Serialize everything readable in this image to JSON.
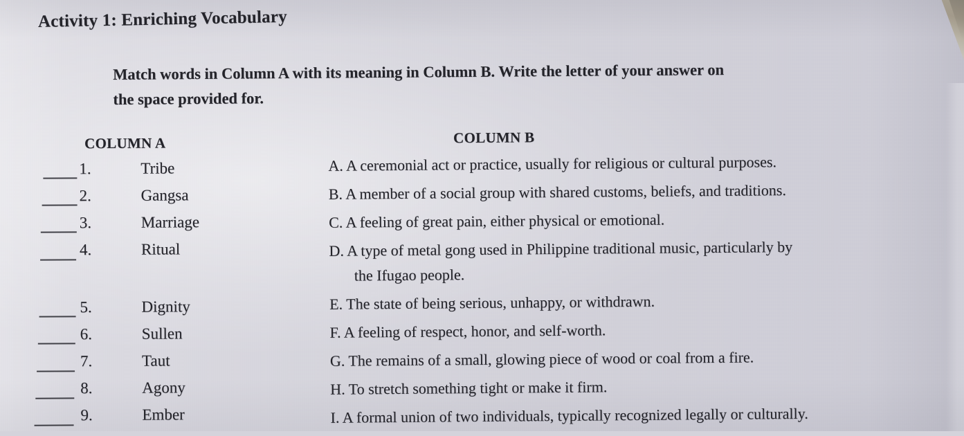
{
  "document": {
    "heading": "Activity 1: Enriching Vocabulary",
    "instructions_line1": "Match words in Column A with its meaning in Column B. Write the letter of your answer on",
    "instructions_line2": "the space provided for.",
    "paper_color": "#d6d5dd",
    "ink_color": "#24242a"
  },
  "column_a": {
    "header": "COLUMN A",
    "items": [
      {
        "number": "1.",
        "word": "Tribe",
        "answer": ""
      },
      {
        "number": "2.",
        "word": "Gangsa",
        "answer": ""
      },
      {
        "number": "3.",
        "word": "Marriage",
        "answer": ""
      },
      {
        "number": "4.",
        "word": "Ritual",
        "answer": ""
      },
      {
        "number": "5.",
        "word": "Dignity",
        "answer": ""
      },
      {
        "number": "6.",
        "word": "Sullen",
        "answer": ""
      },
      {
        "number": "7.",
        "word": "Taut",
        "answer": ""
      },
      {
        "number": "8.",
        "word": "Agony",
        "answer": ""
      },
      {
        "number": "9.",
        "word": "Ember",
        "answer": ""
      }
    ]
  },
  "column_b": {
    "header": "COLUMN B",
    "items": [
      {
        "letter": "A.",
        "text": "A ceremonial act or practice, usually for religious or cultural purposes.",
        "continuation": ""
      },
      {
        "letter": "B.",
        "text": "A member of a social group with shared customs, beliefs, and traditions.",
        "continuation": ""
      },
      {
        "letter": "C.",
        "text": "A feeling of great pain, either physical or emotional.",
        "continuation": ""
      },
      {
        "letter": "D.",
        "text": "A type of metal gong used in Philippine traditional music, particularly by",
        "continuation": "the Ifugao people."
      },
      {
        "letter": "E.",
        "text": "The state of being serious, unhappy, or withdrawn.",
        "continuation": ""
      },
      {
        "letter": "F.",
        "text": "A feeling of respect, honor, and self-worth.",
        "continuation": ""
      },
      {
        "letter": "G.",
        "text": "The remains of a small, glowing piece of wood or coal from a fire.",
        "continuation": ""
      },
      {
        "letter": "H.",
        "text": "To stretch something tight or make it firm.",
        "continuation": ""
      },
      {
        "letter": "I.",
        "text": "A formal union of two individuals, typically recognized legally or culturally.",
        "continuation": ""
      }
    ]
  }
}
